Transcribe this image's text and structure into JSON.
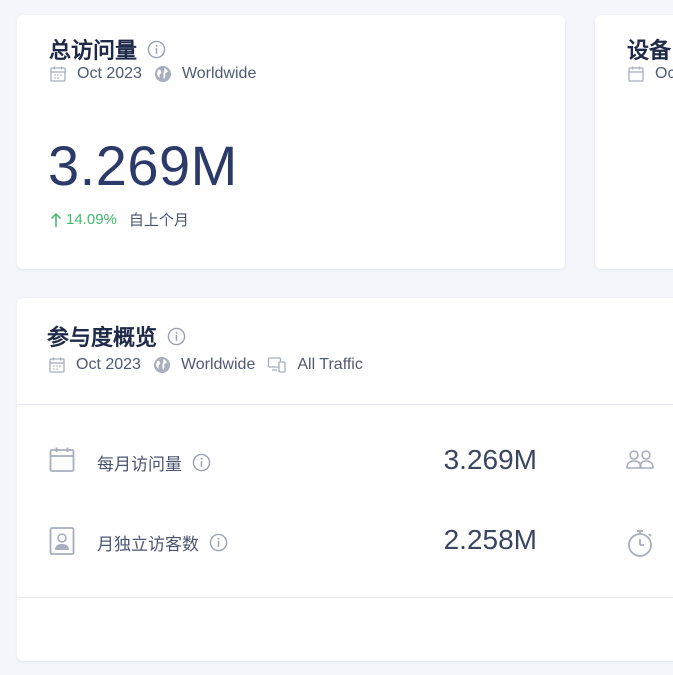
{
  "visits_card": {
    "title": "总访问量",
    "date": "Oct 2023",
    "region": "Worldwide",
    "value": "3.269M",
    "change": "14.09%",
    "change_label": "自上个月",
    "change_color": "#3fb96a"
  },
  "device_card": {
    "title": "设备",
    "date_partial": "Oc"
  },
  "engagement_card": {
    "title": "参与度概览",
    "date": "Oct 2023",
    "region": "Worldwide",
    "traffic": "All Traffic",
    "metrics": [
      {
        "label": "每月访问量",
        "value": "3.269M",
        "icon": "calendar-icon",
        "side_icon": "users-icon"
      },
      {
        "label": "月独立访客数",
        "value": "2.258M",
        "icon": "id-badge-icon",
        "side_icon": "stopwatch-icon"
      }
    ]
  },
  "colors": {
    "accent_number": "#2c3a6a",
    "positive": "#3fb96a",
    "background": "#f4f6fb"
  }
}
